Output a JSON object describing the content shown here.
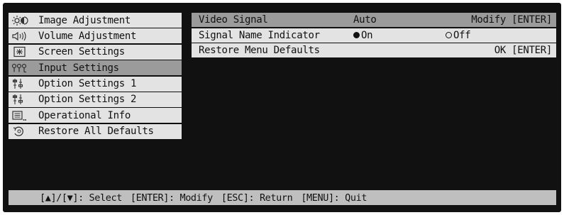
{
  "menu": {
    "items": [
      {
        "label": "Image Adjustment",
        "icon": "image-adjustment-icon"
      },
      {
        "label": "Volume Adjustment",
        "icon": "speaker-icon"
      },
      {
        "label": "Screen Settings",
        "icon": "screen-settings-icon"
      },
      {
        "label": "Input Settings",
        "icon": "input-settings-icon",
        "selected": true
      },
      {
        "label": "Option Settings 1",
        "icon": "option-settings-icon"
      },
      {
        "label": "Option Settings 2",
        "icon": "option-settings-icon"
      },
      {
        "label": "Operational Info",
        "icon": "operational-info-icon"
      },
      {
        "label": "Restore All Defaults",
        "icon": "restore-icon"
      }
    ]
  },
  "panel": {
    "video_signal": {
      "label": "Video Signal",
      "value": "Auto",
      "action": "Modify [ENTER]"
    },
    "signal_name_indicator": {
      "label": "Signal Name Indicator",
      "option_on": "On",
      "option_off": "Off",
      "selected": "On"
    },
    "restore_menu_defaults": {
      "label": "Restore Menu Defaults",
      "action": "OK [ENTER]"
    }
  },
  "footer": {
    "select": "[▲]/[▼]: Select",
    "modify": "[ENTER]: Modify",
    "return": "[ESC]: Return",
    "quit": "[MENU]: Quit"
  }
}
